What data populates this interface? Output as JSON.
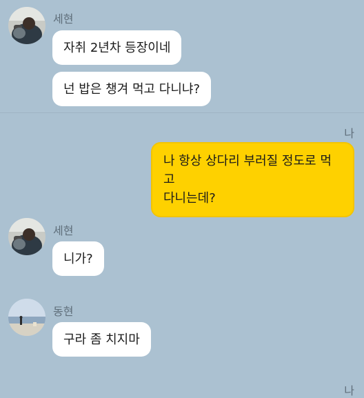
{
  "colors": {
    "background": "#abc1d1",
    "their_bubble": "#ffffff",
    "my_bubble": "#fed100",
    "label_text": "#5f6e7a"
  },
  "messages": [
    {
      "sender": "세현",
      "avatar_icon": "profile-photo-person-icon",
      "bubbles": [
        "자취 2년차 등장이네",
        "넌 밥은 챙겨 먹고 다니냐?"
      ]
    },
    {
      "sender": "나",
      "bubbles": [
        "나 항상 상다리 부러질 정도로 먹고\n다니는데?"
      ]
    },
    {
      "sender": "세현",
      "avatar_icon": "profile-photo-person-icon",
      "bubbles": [
        "니가?"
      ]
    },
    {
      "sender": "동현",
      "avatar_icon": "profile-photo-beach-icon",
      "bubbles": [
        "구라 좀 치지마"
      ]
    },
    {
      "sender": "나",
      "bubbles": []
    }
  ]
}
